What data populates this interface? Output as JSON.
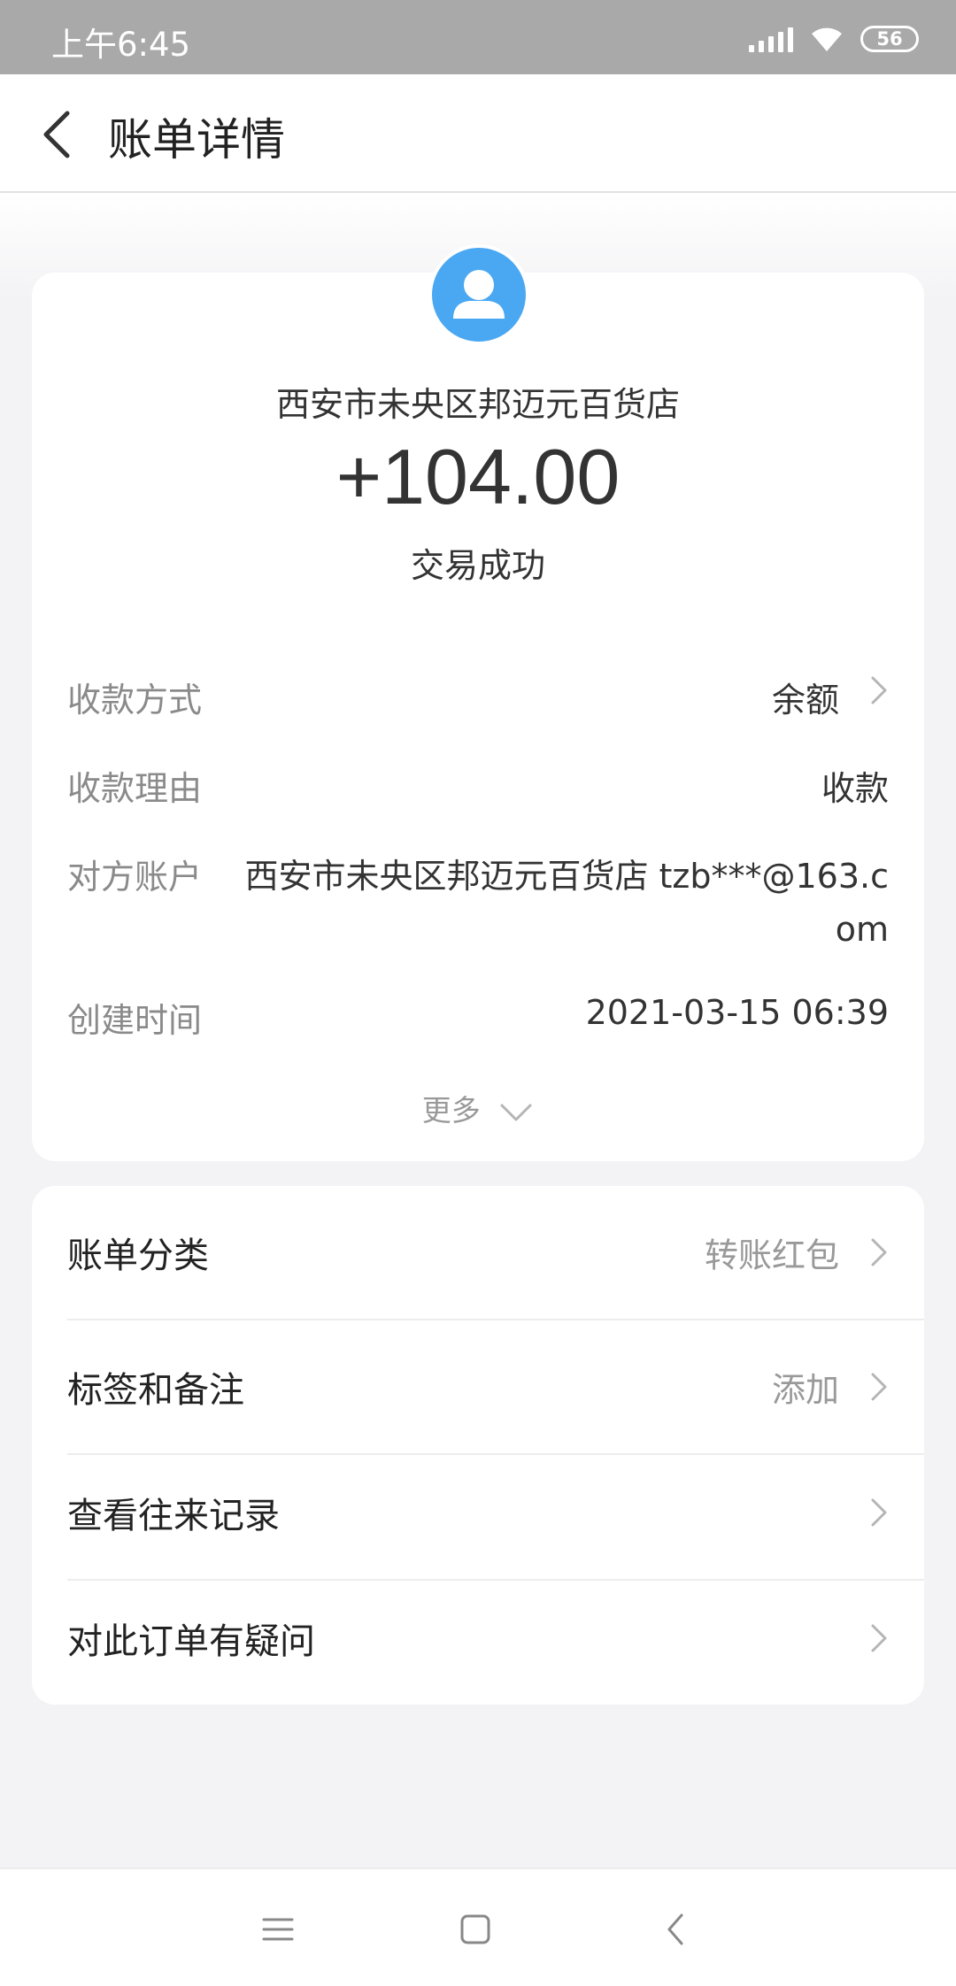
{
  "status_bar": {
    "time": "上午6:45",
    "battery": "56"
  },
  "header": {
    "title": "账单详情"
  },
  "summary": {
    "merchant": "西安市未央区邦迈元百货店",
    "amount": "+104.00",
    "status": "交易成功"
  },
  "details": {
    "method_label": "收款方式",
    "method_value": "余额",
    "reason_label": "收款理由",
    "reason_value": "收款",
    "account_label": "对方账户",
    "account_value": "西安市未央区邦迈元百货店 tzb***@163.com",
    "time_label": "创建时间",
    "time_value": "2021-03-15 06:39",
    "more_label": "更多"
  },
  "menu": {
    "category_label": "账单分类",
    "category_value": "转账红包",
    "tags_label": "标签和备注",
    "tags_value": "添加",
    "history_label": "查看往来记录",
    "question_label": "对此订单有疑问"
  },
  "colors": {
    "accent_blue": "#4aa8f2",
    "status_bar": "#a9a9a9"
  }
}
